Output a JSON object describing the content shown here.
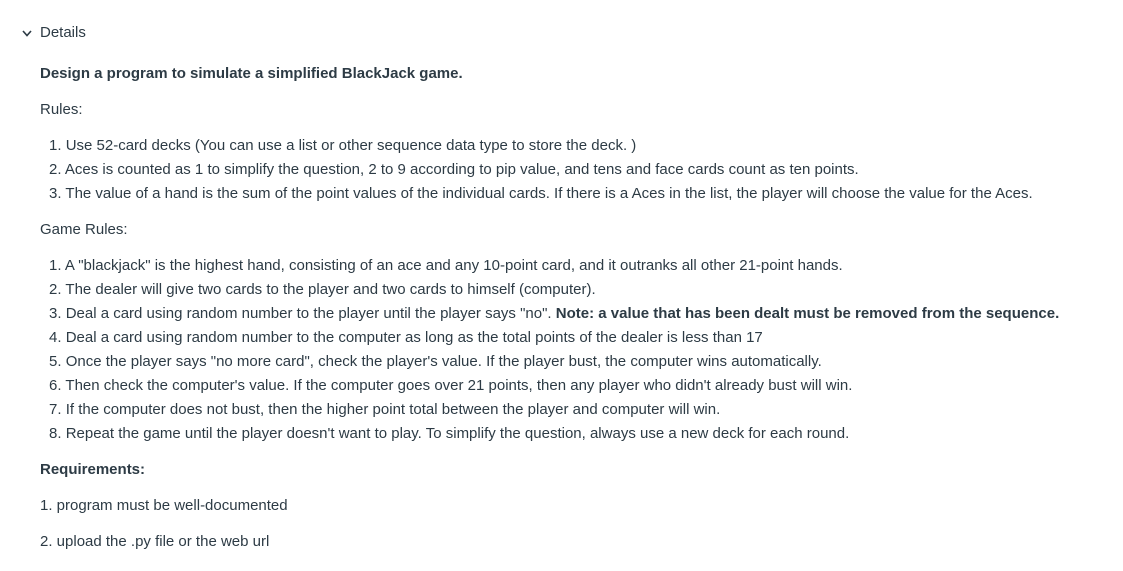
{
  "details": {
    "label": "Details"
  },
  "title": "Design a program to simulate a simplified BlackJack game.",
  "rules_heading": "Rules:",
  "rules": [
    {
      "num": "1.",
      "text": "Use 52-card decks (You can use a list or other sequence data type to store the deck. )"
    },
    {
      "num": "2.",
      "text": "Aces is counted as 1  to simplify the question, 2 to 9 according to pip value, and tens and face cards count as ten points."
    },
    {
      "num": "3.",
      "text": "The value of a hand is the sum of the point values of the individual cards. If there is a Aces in the list, the player will choose the value for the Aces."
    }
  ],
  "game_rules_heading": "Game Rules:",
  "game_rules": [
    {
      "num": "1.",
      "text": "A \"blackjack\" is the highest hand, consisting of an ace and any 10-point card, and it outranks all other 21-point hands."
    },
    {
      "num": "2.",
      "text": "The dealer will give two cards to the player and two cards to himself (computer)."
    },
    {
      "num": "3.",
      "text": "Deal a card using random number to the player until the player says \"no\". ",
      "bold": "Note: a value that has been dealt must be removed from the sequence."
    },
    {
      "num": "4.",
      "text": "Deal a card using random number to the computer as long as the total points of the dealer is less than 17"
    },
    {
      "num": "5.",
      "text": "Once the player says \"no more card\", check the player's value. If the player bust, the computer wins automatically."
    },
    {
      "num": "6.",
      "text": "Then check the computer's value. If the computer goes over 21 points, then any player who didn't already bust will win."
    },
    {
      "num": "7.",
      "text": "If the computer does not bust, then the higher point total between the player and computer will win."
    },
    {
      "num": "8.",
      "text": "Repeat the game until the player doesn't want to play. To simplify the question, always use a new deck for each round."
    }
  ],
  "requirements_heading": "Requirements:",
  "requirements": [
    "1. program must be well-documented",
    "2. upload the .py file or the web url"
  ]
}
